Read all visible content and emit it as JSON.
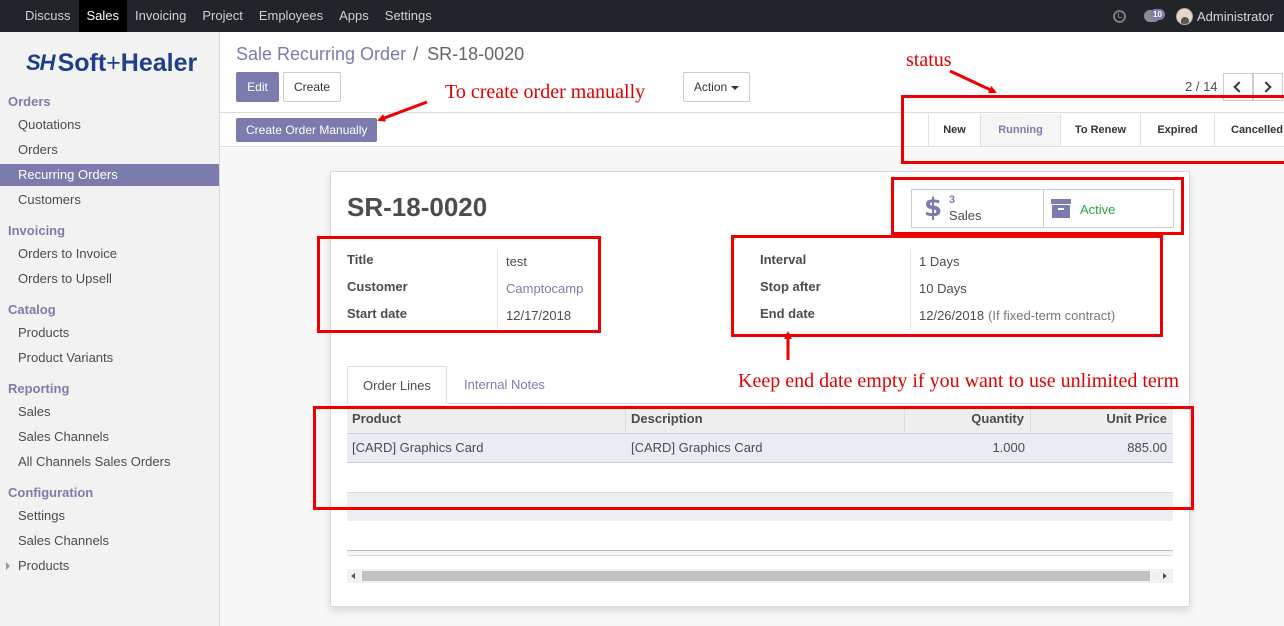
{
  "topbar": {
    "menu": [
      "Discuss",
      "Sales",
      "Invoicing",
      "Project",
      "Employees",
      "Apps",
      "Settings"
    ],
    "active_menu": "Sales",
    "messages_count": "10",
    "user_name": "Administrator"
  },
  "sidebar": {
    "logo_mark": "SH",
    "logo_text": "Soft Healer",
    "sections": [
      {
        "title": "Orders",
        "items": [
          "Quotations",
          "Orders",
          "Recurring Orders",
          "Customers"
        ]
      },
      {
        "title": "Invoicing",
        "items": [
          "Orders to Invoice",
          "Orders to Upsell"
        ]
      },
      {
        "title": "Catalog",
        "items": [
          "Products",
          "Product Variants"
        ]
      },
      {
        "title": "Reporting",
        "items": [
          "Sales",
          "Sales Channels",
          "All Channels Sales Orders"
        ]
      },
      {
        "title": "Configuration",
        "items": [
          "Settings",
          "Sales Channels",
          "Products"
        ]
      }
    ],
    "active_item": "Recurring Orders"
  },
  "control_panel": {
    "breadcrumb_parent": "Sale Recurring Order",
    "breadcrumb_sep": "/",
    "breadcrumb_current": "SR-18-0020",
    "edit_label": "Edit",
    "create_label": "Create",
    "action_label": "Action",
    "pager": "2 / 14",
    "manual_button": "Create Order Manually",
    "stages": [
      "New",
      "Running",
      "To Renew",
      "Expired",
      "Cancelled"
    ],
    "active_stage": "Running"
  },
  "form": {
    "record_name": "SR-18-0020",
    "smart_buttons": {
      "sales_count": "3",
      "sales_label": "Sales",
      "active_label": "Active"
    },
    "left_fields": [
      {
        "label": "Title",
        "value": "test"
      },
      {
        "label": "Customer",
        "value": "Camptocamp"
      },
      {
        "label": "Start date",
        "value": "12/17/2018"
      }
    ],
    "right_fields": [
      {
        "label": "Interval",
        "value": "1 Days"
      },
      {
        "label": "Stop after",
        "value": "10 Days"
      },
      {
        "label": "End date",
        "value": "12/26/2018",
        "hint": "(If fixed-term contract)"
      }
    ],
    "tabs": [
      "Order Lines",
      "Internal Notes"
    ],
    "table": {
      "columns": [
        "Product",
        "Description",
        "Quantity",
        "Unit Price"
      ],
      "rows": [
        {
          "product": "[CARD] Graphics Card",
          "description": "[CARD] Graphics Card",
          "quantity": "1.000",
          "unit_price": "885.00"
        }
      ]
    }
  },
  "annotations": {
    "status": "status",
    "manual": "To create order manually",
    "end_date": "Keep end date empty if you want to use unlimited term"
  },
  "colors": {
    "accent": "#7c7bad",
    "annotation_red": "#ee0000",
    "topbar": "#212529"
  }
}
